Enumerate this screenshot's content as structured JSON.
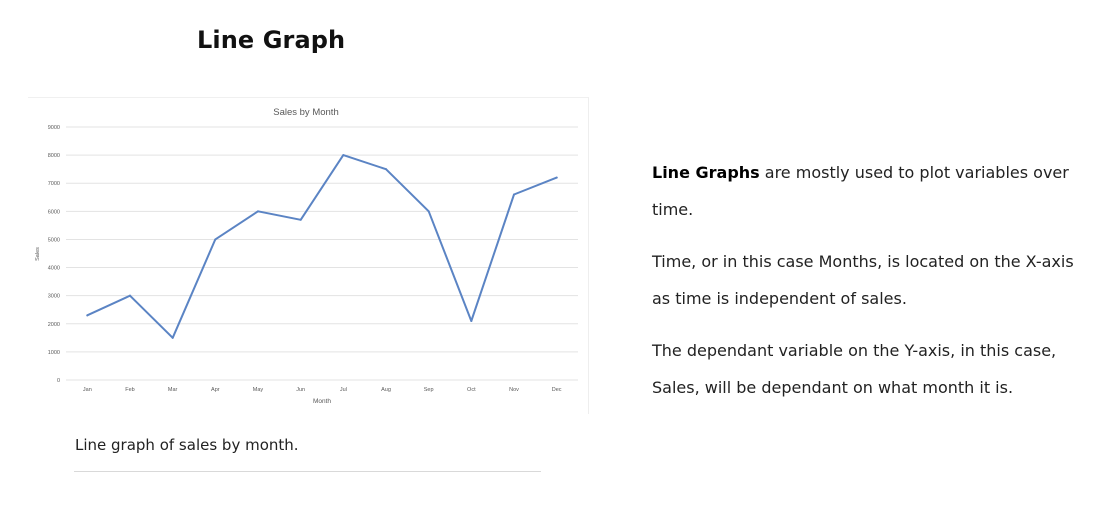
{
  "page": {
    "title": "Line Graph",
    "caption": "Line graph of sales by month."
  },
  "description": {
    "p1_bold": "Line Graphs",
    "p1_rest": " are mostly used to plot variables over time.",
    "p2": "Time, or in this case Months, is located on the X-axis as time is independent of sales.",
    "p3": "The dependant variable on the Y-axis, in this case, Sales, will be dependant on what month it is."
  },
  "chart_data": {
    "type": "line",
    "title": "Sales by Month",
    "xlabel": "Month",
    "ylabel": "Sales",
    "categories": [
      "Jan",
      "Feb",
      "Mar",
      "Apr",
      "May",
      "Jun",
      "Jul",
      "Aug",
      "Sep",
      "Oct",
      "Nov",
      "Dec"
    ],
    "series": [
      {
        "values": [
          2300,
          3000,
          1500,
          5000,
          6000,
          5700,
          8000,
          7500,
          6000,
          2100,
          6600,
          7200
        ]
      }
    ],
    "ylim": [
      0,
      9000
    ],
    "yticks": [
      0,
      1000,
      2000,
      3000,
      4000,
      5000,
      6000,
      7000,
      8000,
      9000
    ],
    "grid": true,
    "legend": "none",
    "line_color": "#5b84c4",
    "grid_color": "#e3e3e3"
  }
}
